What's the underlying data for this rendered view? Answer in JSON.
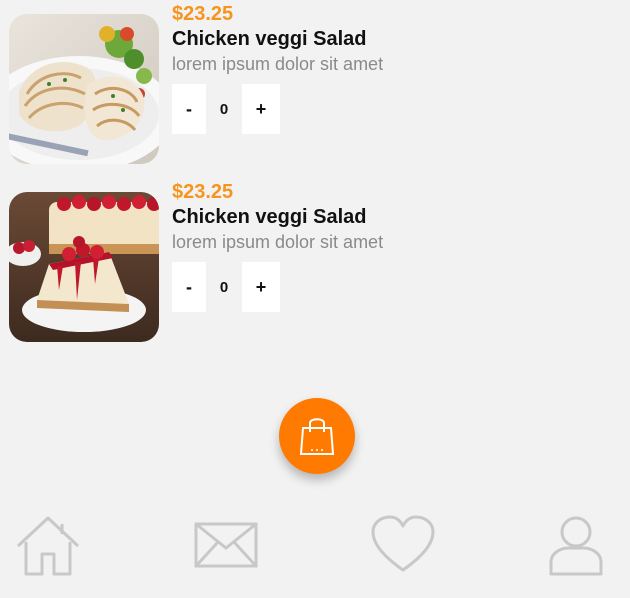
{
  "items": [
    {
      "price": "$23.25",
      "title": "Chicken veggi Salad",
      "description": "lorem ipsum dolor sit amet",
      "quantity": "0",
      "minus_label": "-",
      "plus_label": "+",
      "image": "grilled-fish-salad-photo"
    },
    {
      "price": "$23.25",
      "title": "Chicken veggi Salad",
      "description": "lorem ipsum dolor sit amet",
      "quantity": "0",
      "minus_label": "-",
      "plus_label": "+",
      "image": "cherry-cheesecake-photo"
    }
  ],
  "cart_button": {
    "icon": "shopping-bag-icon",
    "color": "#ff7a00"
  },
  "bottom_nav": [
    {
      "icon": "home-icon"
    },
    {
      "icon": "mail-icon"
    },
    {
      "icon": "heart-icon"
    },
    {
      "icon": "user-icon"
    }
  ],
  "colors": {
    "accent": "#f7941d",
    "background": "#f2f2f2",
    "nav_icon": "#c8c8c8"
  }
}
